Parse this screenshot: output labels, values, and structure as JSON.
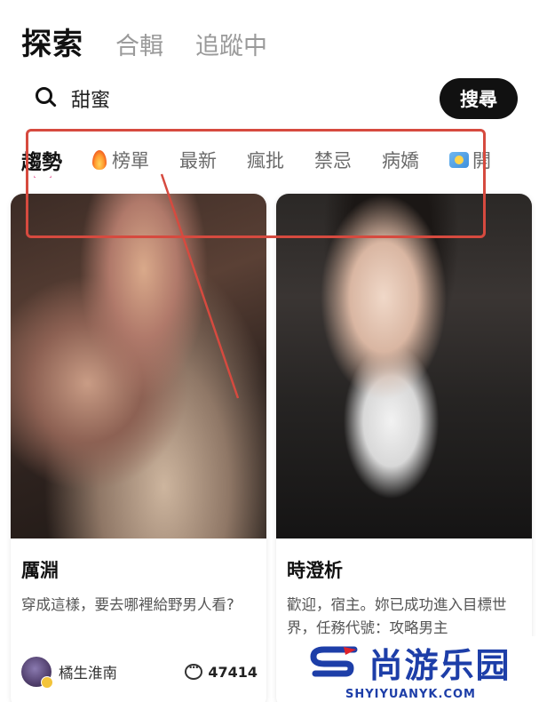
{
  "top_tabs": [
    {
      "label": "探索",
      "active": true
    },
    {
      "label": "合輯",
      "active": false
    },
    {
      "label": "追蹤中",
      "active": false
    }
  ],
  "search": {
    "value": "甜蜜",
    "button_label": "搜尋",
    "icon": "search-icon"
  },
  "categories": [
    {
      "label": "趨勢",
      "active": true
    },
    {
      "label": "榜單",
      "icon": "flame-icon"
    },
    {
      "label": "最新"
    },
    {
      "label": "瘋批"
    },
    {
      "label": "禁忌"
    },
    {
      "label": "病嬌"
    },
    {
      "label": "開",
      "icon": "badge-icon"
    }
  ],
  "cards": [
    {
      "name": "厲淵",
      "description": "穿成這樣，要去哪裡給野男人看?",
      "author": "橘生淮南",
      "comments": "47414"
    },
    {
      "name": "時澄析",
      "description": "歡迎，宿主。妳已成功進入目標世界，任務代號：攻略男主"
    }
  ],
  "watermark": {
    "text": "尚游乐园",
    "subtext": "SHYIYUANYK.COM"
  },
  "colors": {
    "accent_pink": "#e0307a",
    "annotation_red": "#d64a3f",
    "watermark_blue": "#1d3ea8",
    "button_black": "#111111"
  }
}
